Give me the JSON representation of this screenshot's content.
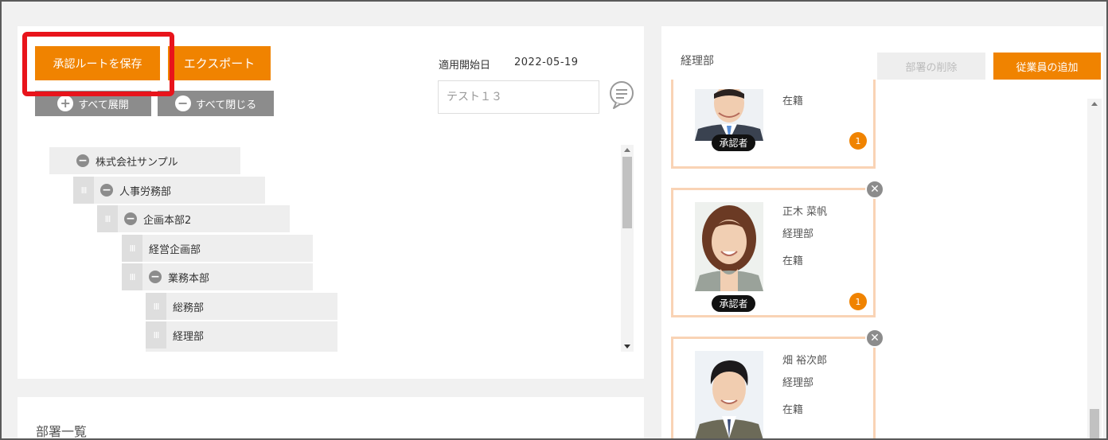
{
  "toolbar": {
    "save_route_label": "承認ルートを保存",
    "export_label": "エクスポート",
    "expand_all_label": "すべて展開",
    "collapse_all_label": "すべて閉じる"
  },
  "route": {
    "start_date_label": "適用開始日",
    "start_date_value": "2022-05-19",
    "name_placeholder": "テスト１３"
  },
  "tree": {
    "nodes": [
      {
        "label": "株式会社サンプル"
      },
      {
        "label": "人事労務部"
      },
      {
        "label": "企画本部2"
      },
      {
        "label": "経営企画部"
      },
      {
        "label": "業務本部"
      },
      {
        "label": "総務部"
      },
      {
        "label": "経理部"
      }
    ]
  },
  "department_list": {
    "title": "部署一覧"
  },
  "department_detail": {
    "title": "経理部",
    "delete_label": "部署の削除",
    "add_employee_label": "従業員の追加"
  },
  "employees": [
    {
      "name": "",
      "dept": "",
      "status": "在籍",
      "role": "承認者",
      "order": "1"
    },
    {
      "name": "正木 菜帆",
      "dept": "経理部",
      "status": "在籍",
      "role": "承認者",
      "order": "1"
    },
    {
      "name": "畑 裕次郎",
      "dept": "経理部",
      "status": "在籍"
    }
  ],
  "colors": {
    "accent": "#f08300",
    "highlight": "#e8141b",
    "card_border": "#f9d3b5"
  }
}
